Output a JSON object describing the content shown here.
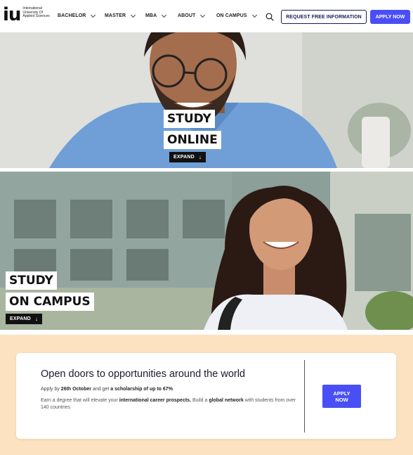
{
  "brand": {
    "logo_mark": "iu",
    "logo_text": "International University Of Applied Sciences"
  },
  "nav": {
    "items": [
      {
        "label": "BACHELOR"
      },
      {
        "label": "MASTER"
      },
      {
        "label": "MBA"
      },
      {
        "label": "ABOUT"
      },
      {
        "label": "ON CAMPUS"
      }
    ],
    "search_icon": "search-icon",
    "request_label": "REQUEST FREE INFORMATION",
    "apply_label": "APPLY NOW"
  },
  "hero": {
    "online": {
      "line1": "STUDY",
      "line2": "ONLINE",
      "expand": "EXPAND"
    },
    "campus": {
      "line1": "STUDY",
      "line2": "ON CAMPUS",
      "expand": "EXPAND"
    }
  },
  "promo": {
    "title": "Open doors to opportunities around the world",
    "line1_pre": "Apply by ",
    "line1_date": "26th October",
    "line1_mid": " and get ",
    "line1_offer": "a scholarship of up to 67%",
    "line2_a": "Earn a degree that will elevate your ",
    "line2_b": "international career prospects.",
    "line2_c": " Build a ",
    "line2_d": "global network",
    "line2_e": " with students from over 140 countries",
    "apply_line1": "APPLY",
    "apply_line2": "NOW"
  },
  "colors": {
    "accent": "#4a4ff5",
    "navy": "#1b1b5e",
    "promo_band": "#fde2c1"
  }
}
